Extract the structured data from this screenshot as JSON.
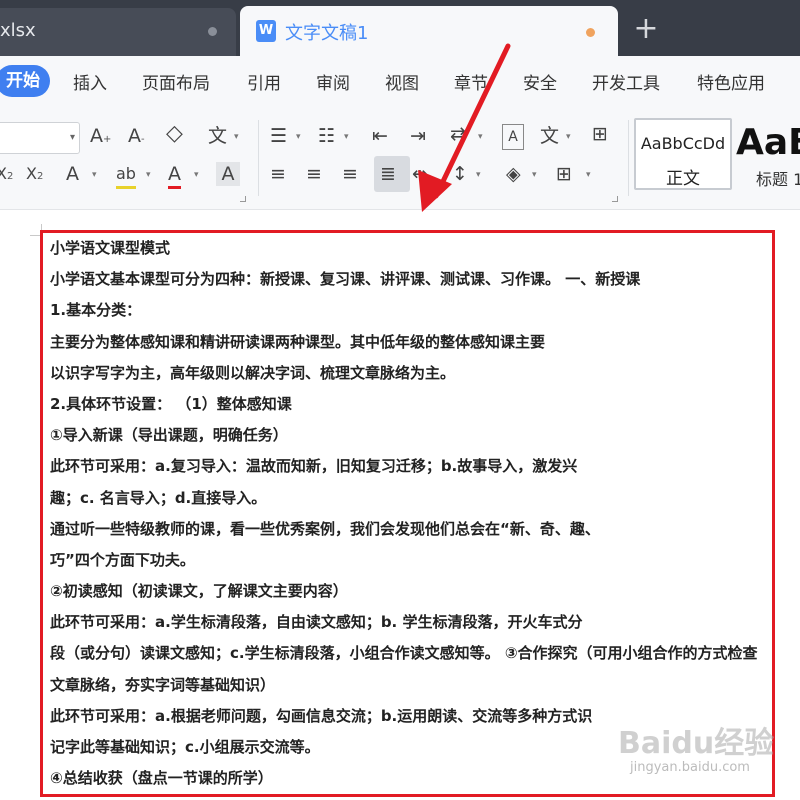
{
  "tabs": {
    "inactive": {
      "label": "xlsx"
    },
    "active": {
      "icon_letter": "W",
      "label": "文字文稿1"
    },
    "new_tab": "+"
  },
  "menu": {
    "items": [
      "开始",
      "插入",
      "页面布局",
      "引用",
      "审阅",
      "视图",
      "章节",
      "安全",
      "开发工具",
      "特色应用"
    ]
  },
  "toolbar": {
    "grow_font": "A",
    "shrink_font": "A",
    "clear_format": "◇",
    "pinyin": "文",
    "superscript": "X",
    "subscript": "X",
    "text_effect": "A",
    "highlight": "ab",
    "font_color": "A",
    "char_shading": "A",
    "sort": "A",
    "chinese_layout": "文"
  },
  "styles": {
    "normal": {
      "sample": "AaBbCcDd",
      "name": "正文"
    },
    "heading": {
      "sample": "AaB",
      "name": "标题 1"
    }
  },
  "document": {
    "lines": [
      "小学语文课型模式",
      "小学语文基本课型可分为四种：新授课、复习课、讲评课、测试课、习作课。 一、新授课",
      "1.基本分类：",
      "主要分为整体感知课和精讲研读课两种课型。其中低年级的整体感知课主要",
      "以识字写字为主，高年级则以解决字词、梳理文章脉络为主。",
      "2.具体环节设置：  （1）整体感知课",
      "①导入新课（导出课题，明确任务）",
      "此环节可采用：a.复习导入：温故而知新，旧知复习迁移；b.故事导入，激发兴",
      "趣；c. 名言导入；d.直接导入。",
      "通过听一些特级教师的课，看一些优秀案例，我们会发现他们总会在“新、奇、趣、",
      "巧”四个方面下功夫。",
      "②初读感知（初读课文，了解课文主要内容）",
      "此环节可采用：a.学生标清段落，自由读文感知；b. 学生标清段落，开火车式分",
      "段（或分句）读课文感知；c.学生标清段落，小组合作读文感知等。 ③合作探究（可用小组合作的方式检查",
      "文章脉络，夯实字词等基础知识）",
      "此环节可采用：a.根据老师问题，勾画信息交流；b.运用朗读、交流等多种方式识",
      "记字此等基础知识；c.小组展示交流等。",
      "④总结收获（盘点一节课的所学）"
    ]
  },
  "watermark": {
    "brand": "Baidu经验",
    "url": "jingyan.baidu.com"
  },
  "colors": {
    "accent": "#3f7ff0",
    "annotation": "#e21b23",
    "tab_bar": "#383d47"
  }
}
